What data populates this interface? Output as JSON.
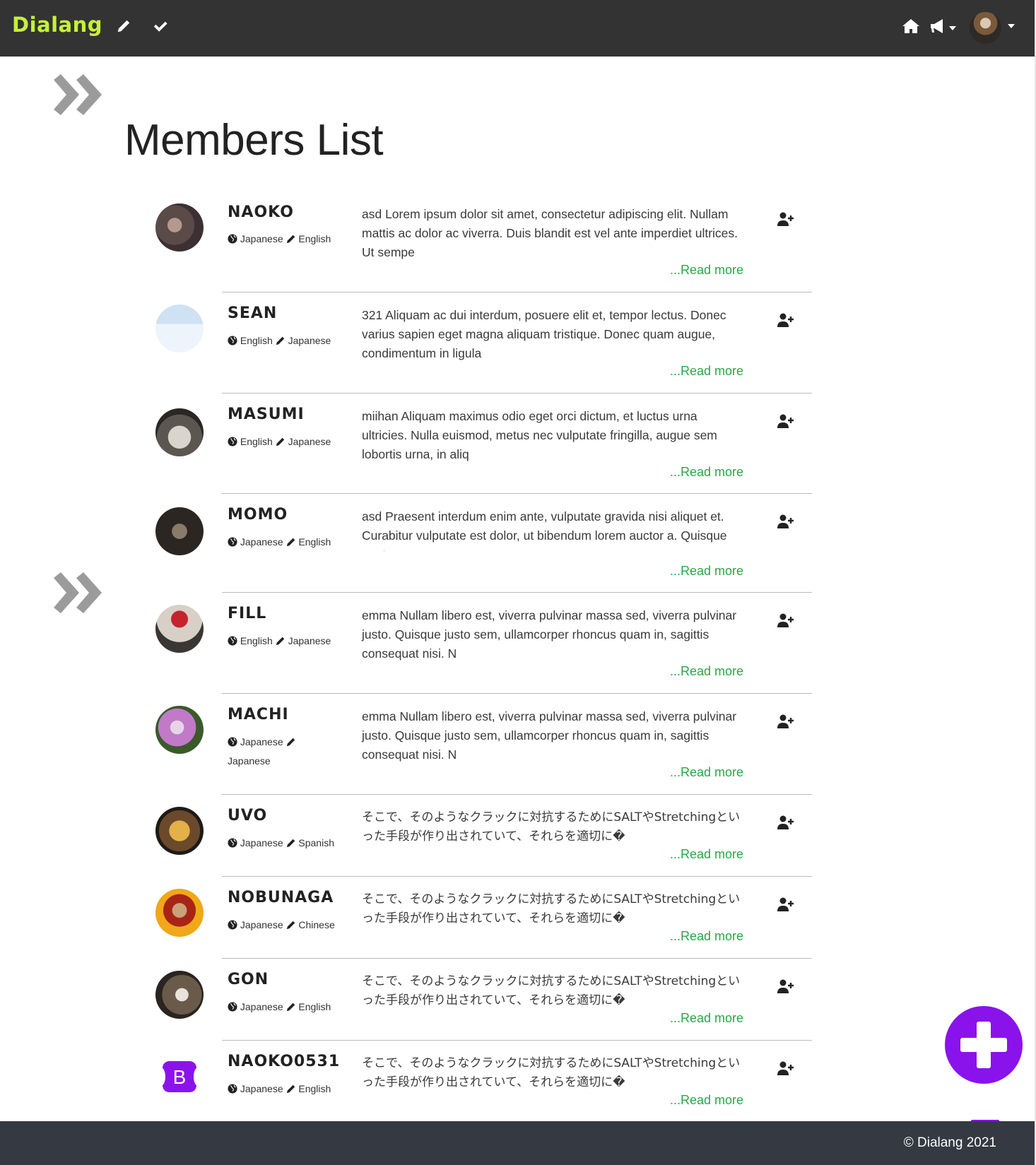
{
  "app": {
    "brand": "Dialang"
  },
  "navbar": {
    "icons": [
      "pencil-icon",
      "check-icon",
      "home-icon",
      "megaphone-icon",
      "user-avatar"
    ]
  },
  "page": {
    "title": "Members List"
  },
  "members": [
    {
      "name": "NAOKO",
      "native": "Japanese",
      "learning": "English",
      "bio": "asd Lorem ipsum dolor sit amet, consectetur adipiscing elit. Nullam mattis ac dolor ac viverra. Duis blandit est vel ante imperdiet ultrices. Ut sempe",
      "read_more": "...Read more"
    },
    {
      "name": "SEAN",
      "native": "English",
      "learning": "Japanese",
      "bio": "321 Aliquam ac dui interdum, posuere elit et, tempor lectus. Donec varius sapien eget magna aliquam tristique. Donec quam augue, condimentum in ligula",
      "read_more": "...Read more"
    },
    {
      "name": "MASUMI",
      "native": "English",
      "learning": "Japanese",
      "bio": "miihan Aliquam maximus odio eget orci dictum, et luctus urna ultricies. Nulla euismod, metus nec vulputate fringilla, augue sem lobortis urna, in aliq",
      "read_more": "...Read more"
    },
    {
      "name": "MOMO",
      "native": "Japanese",
      "learning": "English",
      "bio": "asd Praesent interdum enim ante, vulputate gravida nisi aliquet et. Curabitur vulputate est dolor, ut bibendum lorem auctor a. Quisque eget massa grav",
      "read_more": "...Read more"
    },
    {
      "name": "FILL",
      "native": "English",
      "learning": "Japanese",
      "bio": "emma Nullam libero est, viverra pulvinar massa sed, viverra pulvinar justo. Quisque justo sem, ullamcorper rhoncus quam in, sagittis consequat nisi. N",
      "read_more": "...Read more"
    },
    {
      "name": "MACHI",
      "native": "Japanese",
      "learning": "Japanese",
      "bio": "emma Nullam libero est, viverra pulvinar massa sed, viverra pulvinar justo. Quisque justo sem, ullamcorper rhoncus quam in, sagittis consequat nisi. N",
      "read_more": "...Read more"
    },
    {
      "name": "UVO",
      "native": "Japanese",
      "learning": "Spanish",
      "bio": "そこで、そのようなクラックに対抗するためにSALTやStretchingといった手段が作り出されていて、それらを適切に�",
      "read_more": "...Read more"
    },
    {
      "name": "NOBUNAGA",
      "native": "Japanese",
      "learning": "Chinese",
      "bio": "そこで、そのようなクラックに対抗するためにSALTやStretchingといった手段が作り出されていて、それらを適切に�",
      "read_more": "...Read more"
    },
    {
      "name": "GON",
      "native": "Japanese",
      "learning": "English",
      "bio": "そこで、そのようなクラックに対抗するためにSALTやStretchingといった手段が作り出されていて、それらを適切に�",
      "read_more": "...Read more"
    },
    {
      "name": "NAOKO0531",
      "native": "Japanese",
      "learning": "English",
      "bio": "そこで、そのようなクラックに対抗するためにSALTやStretchingといった手段が作り出されていて、それらを適切に�",
      "read_more": "...Read more"
    }
  ],
  "avatar_letter": "B",
  "colors": {
    "accent_green": "#28a745",
    "brand_lime": "#c6f236",
    "fab_purple": "#8a13ec",
    "navbar": "#333333",
    "footer": "#353942"
  },
  "footer": {
    "copyright": "© Dialang 2021"
  }
}
